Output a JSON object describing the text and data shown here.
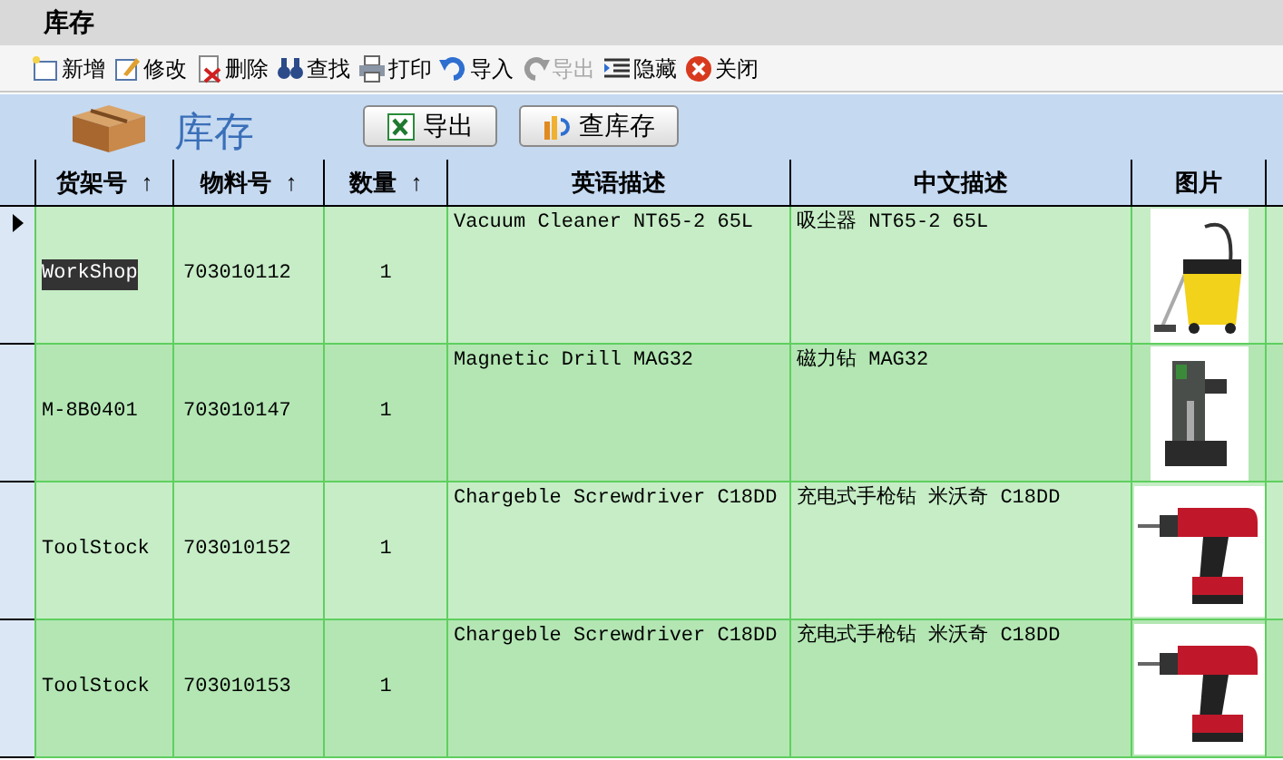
{
  "window": {
    "title": "库存"
  },
  "toolbar": [
    {
      "label": "新增",
      "kind": "new",
      "disabled": false
    },
    {
      "label": "修改",
      "kind": "edit",
      "disabled": false
    },
    {
      "label": "删除",
      "kind": "delete",
      "disabled": false
    },
    {
      "label": "查找",
      "kind": "find",
      "disabled": false
    },
    {
      "label": "打印",
      "kind": "print",
      "disabled": false
    },
    {
      "label": "导入",
      "kind": "import",
      "disabled": false
    },
    {
      "label": "导出",
      "kind": "export",
      "disabled": true
    },
    {
      "label": "隐藏",
      "kind": "hide",
      "disabled": false
    },
    {
      "label": "关闭",
      "kind": "close",
      "disabled": false
    }
  ],
  "header": {
    "title": "库存",
    "buttons": [
      {
        "label": "导出",
        "kind": "excel"
      },
      {
        "label": "查库存",
        "kind": "stock"
      }
    ]
  },
  "table": {
    "columns": [
      {
        "label": "货架号",
        "sort": "↑"
      },
      {
        "label": "物料号",
        "sort": "↑"
      },
      {
        "label": "数量",
        "sort": "↑"
      },
      {
        "label": "英语描述"
      },
      {
        "label": "中文描述"
      },
      {
        "label": "图片"
      }
    ],
    "rows": [
      {
        "selected": true,
        "shelf": "WorkShop",
        "material": "703010112",
        "qty": "1",
        "english": "Vacuum Cleaner NT65-2 65L",
        "chinese": "吸尘器 NT65-2 65L"
      },
      {
        "selected": false,
        "shelf": "M-8B0401",
        "material": "703010147",
        "qty": "1",
        "english": "Magnetic Drill MAG32",
        "chinese": "磁力钻 MAG32"
      },
      {
        "selected": false,
        "shelf": "ToolStock",
        "material": "703010152",
        "qty": "1",
        "english": "Chargeble Screwdriver C18DD",
        "chinese": "充电式手枪钻 米沃奇 C18DD"
      },
      {
        "selected": false,
        "shelf": "ToolStock",
        "material": "703010153",
        "qty": "1",
        "english": "Chargeble Screwdriver C18DD",
        "chinese": "充电式手枪钻 米沃奇 C18DD"
      }
    ]
  }
}
